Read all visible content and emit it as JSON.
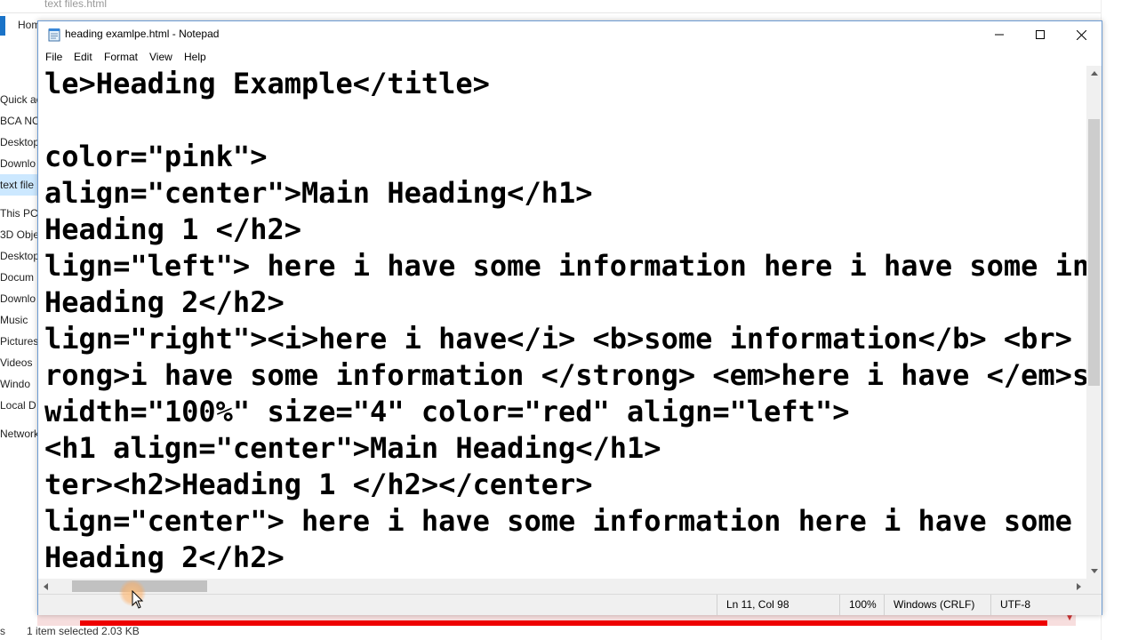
{
  "background": {
    "explorer_title": "text files.html",
    "home_tab": "Home",
    "nav_items": [
      "Quick ac",
      "BCA NO",
      "Desktop",
      "Downlo",
      "text file",
      "This PC",
      "3D Obje",
      "Desktop",
      "Docum",
      "Downlo",
      "Music",
      "Pictures",
      "Videos",
      "Windo",
      "Local D",
      "Network"
    ],
    "selected_nav": 4,
    "status_left": "1 item selected  2.03 KB",
    "status_prefix": "s"
  },
  "notepad": {
    "title": "heading examlpe.html - Notepad",
    "menu": [
      "File",
      "Edit",
      "Format",
      "View",
      "Help"
    ],
    "lines": [
      "le>Heading Example</title>",
      "",
      "color=\"pink\">",
      "align=\"center\">Main Heading</h1>",
      "Heading 1 </h2>",
      "lign=\"left\"> here i have some information here i have some inf",
      "Heading 2</h2>",
      "lign=\"right\"><i>here i have</i> <b>some information</b> <br>",
      "rong>i have some information </strong> <em>here i have </em>so",
      "width=\"100%\" size=\"4\" color=\"red\" align=\"left\">",
      "<h1 align=\"center\">Main Heading</h1>",
      "ter><h2>Heading 1 </h2></center>",
      "lign=\"center\"> here i have some information here i have some i",
      "Heading 2</h2>"
    ],
    "status": {
      "position": "Ln 11, Col 98",
      "zoom": "100%",
      "line_ending": "Windows (CRLF)",
      "encoding": "UTF-8"
    }
  },
  "icons": {
    "app": "notepad-icon",
    "minimize": "minimize-icon",
    "maximize": "maximize-icon",
    "close": "close-icon",
    "cursor": "mouse-cursor-icon"
  },
  "colors": {
    "accent": "#1a73c8",
    "red_bar": "#ee0000",
    "selection": "#cce8ff"
  }
}
